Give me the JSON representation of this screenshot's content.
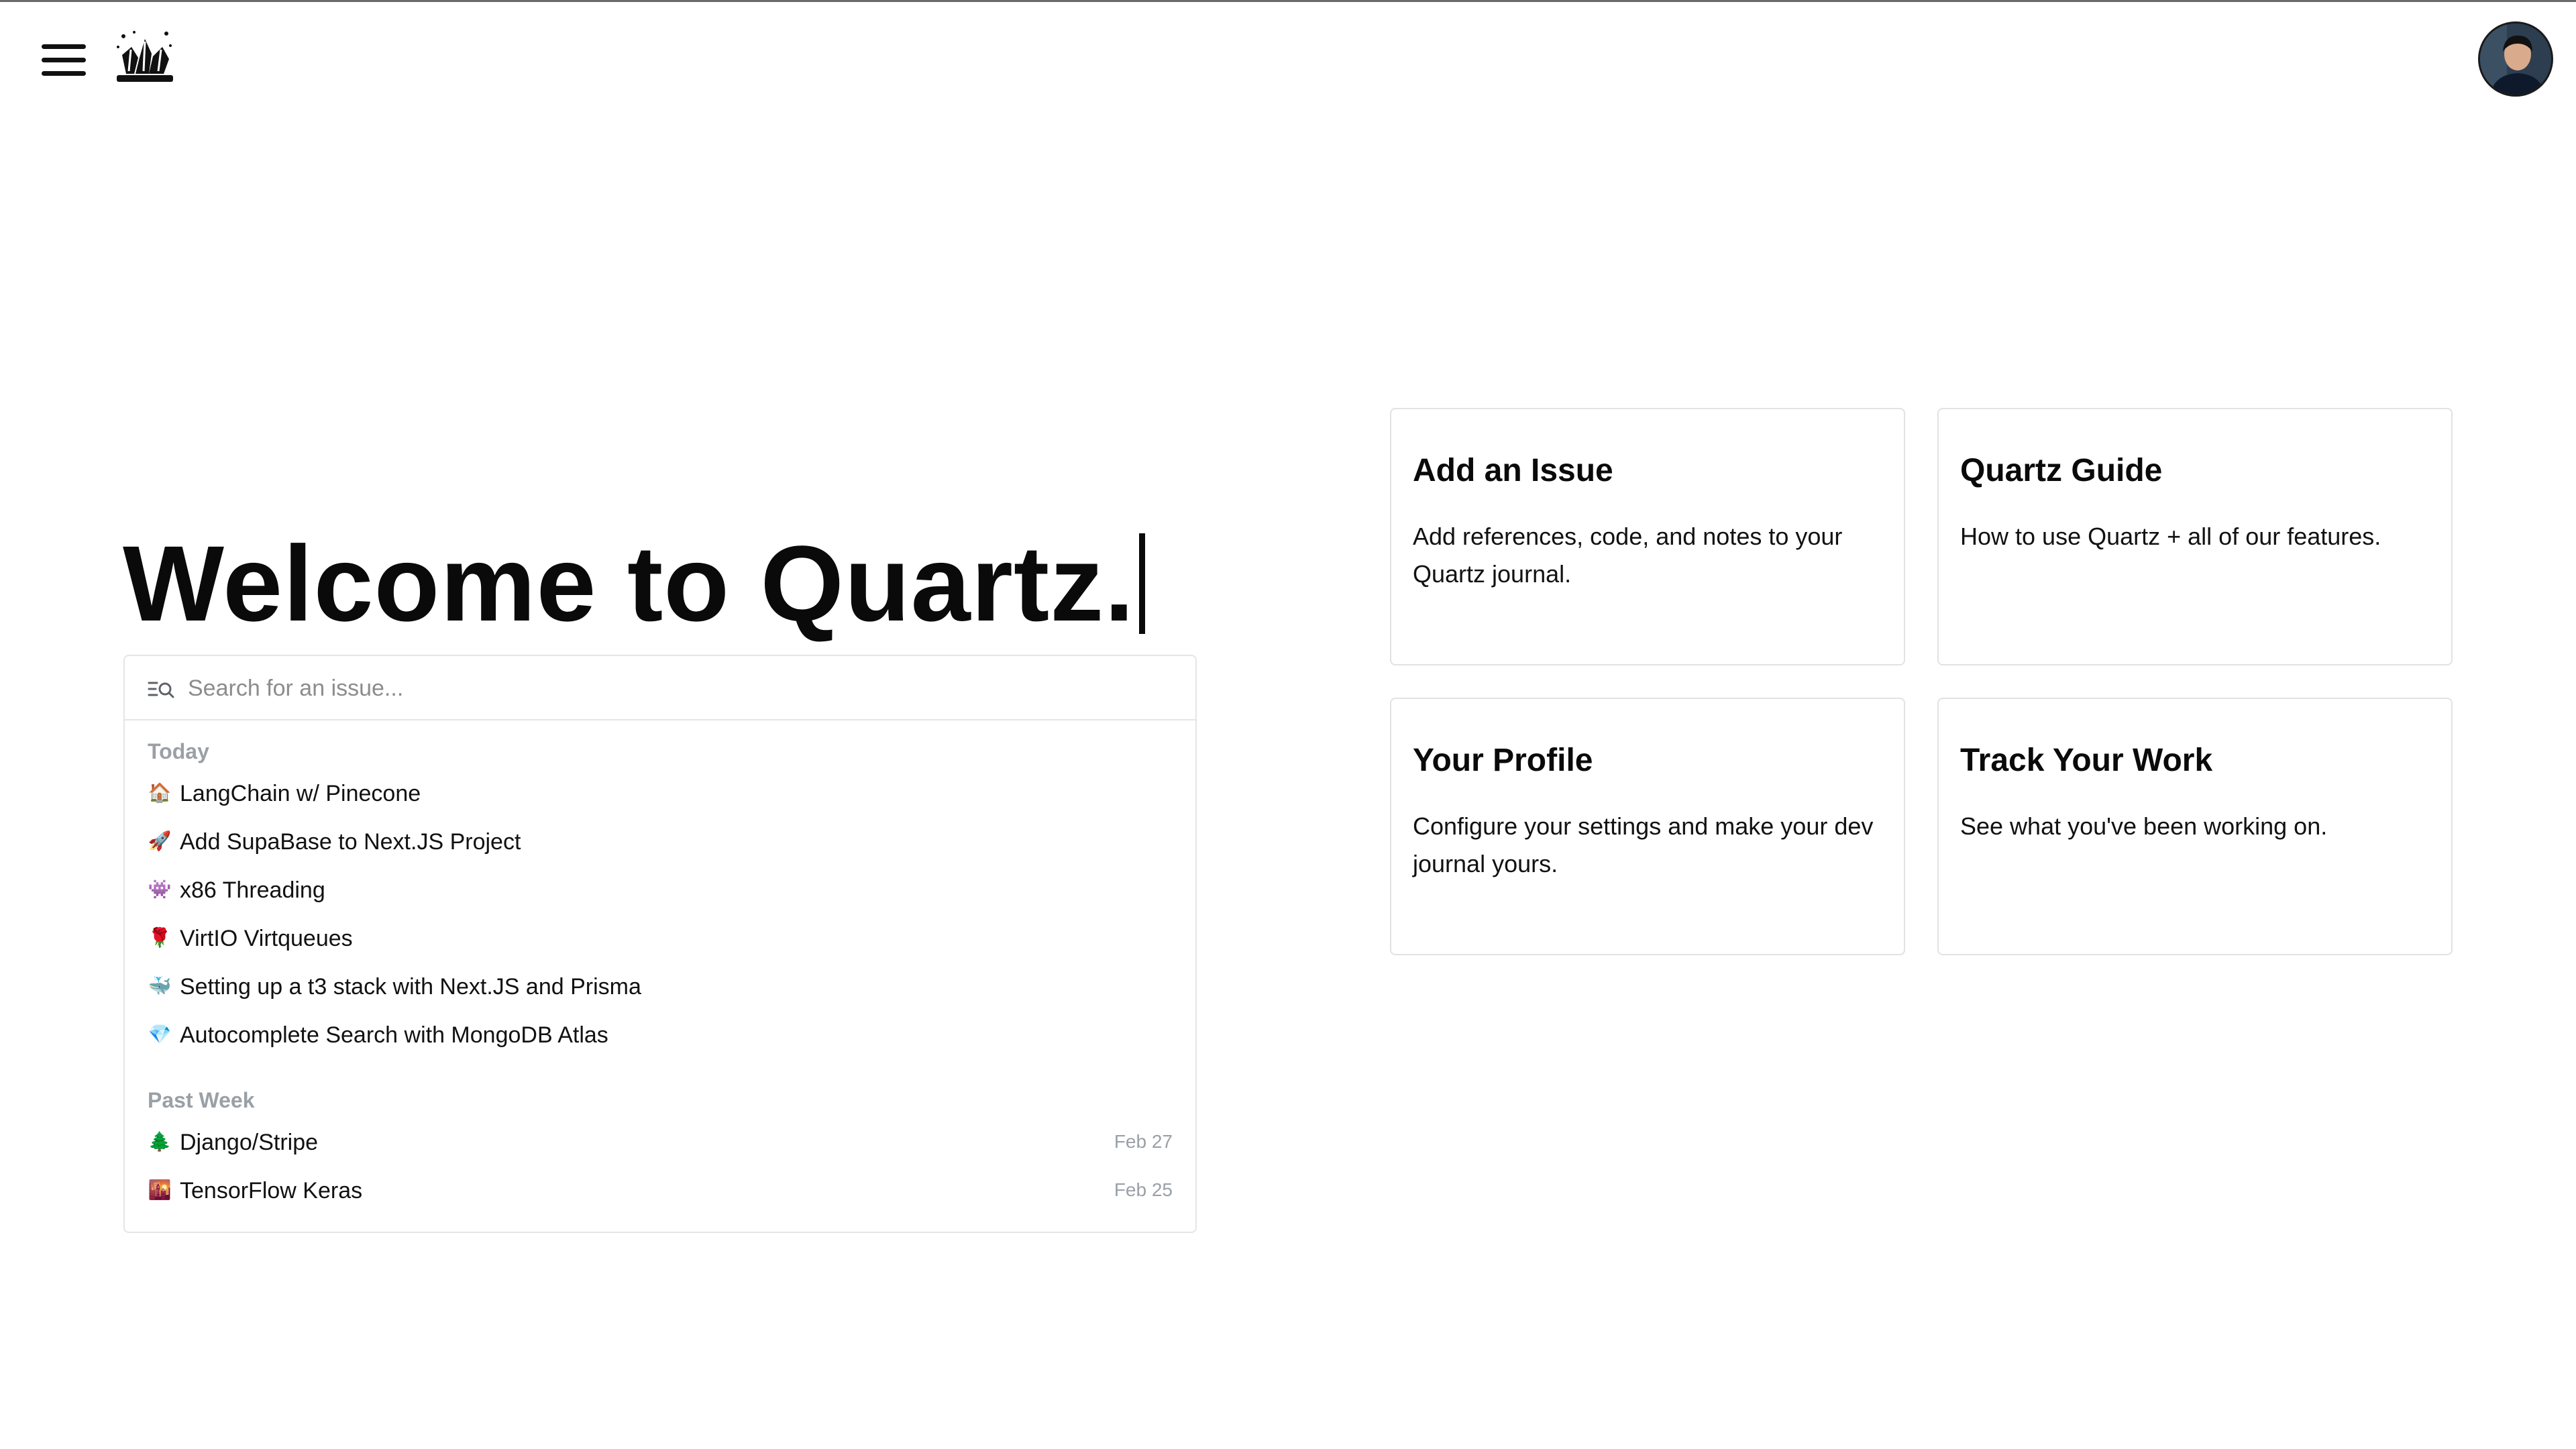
{
  "header": {
    "menu_icon": "hamburger-menu-icon",
    "logo_icon": "quartz-crystal-logo",
    "avatar_icon": "user-avatar-photo"
  },
  "hero": {
    "title": "Welcome to Quartz."
  },
  "search": {
    "icon": "list-search-icon",
    "placeholder": "Search for an issue...",
    "value": ""
  },
  "issues": {
    "today_label": "Today",
    "today": [
      {
        "emoji": "🏠",
        "title": "LangChain w/ Pinecone"
      },
      {
        "emoji": "🚀",
        "title": "Add SupaBase to Next.JS Project"
      },
      {
        "emoji": "👾",
        "title": "x86 Threading"
      },
      {
        "emoji": "🌹",
        "title": "VirtIO Virtqueues"
      },
      {
        "emoji": "🐳",
        "title": "Setting up a t3 stack with Next.JS and Prisma"
      },
      {
        "emoji": "💎",
        "title": "Autocomplete Search with MongoDB Atlas"
      }
    ],
    "past_week_label": "Past Week",
    "past_week": [
      {
        "emoji": "🌲",
        "title": "Django/Stripe",
        "date": "Feb 27"
      },
      {
        "emoji": "🌇",
        "title": "TensorFlow Keras",
        "date": "Feb 25"
      }
    ]
  },
  "cards": [
    {
      "title": "Add an Issue",
      "description": "Add references, code, and notes to your Quartz journal."
    },
    {
      "title": "Quartz Guide",
      "description": "How to use Quartz + all of our features."
    },
    {
      "title": "Your Profile",
      "description": "Configure your settings and make your dev journal yours."
    },
    {
      "title": "Track Your Work",
      "description": "See what you've been working on."
    }
  ],
  "colors": {
    "text": "#0a0a0a",
    "muted": "#9aa0a6",
    "border": "#e5e5e5",
    "background": "#ffffff"
  }
}
